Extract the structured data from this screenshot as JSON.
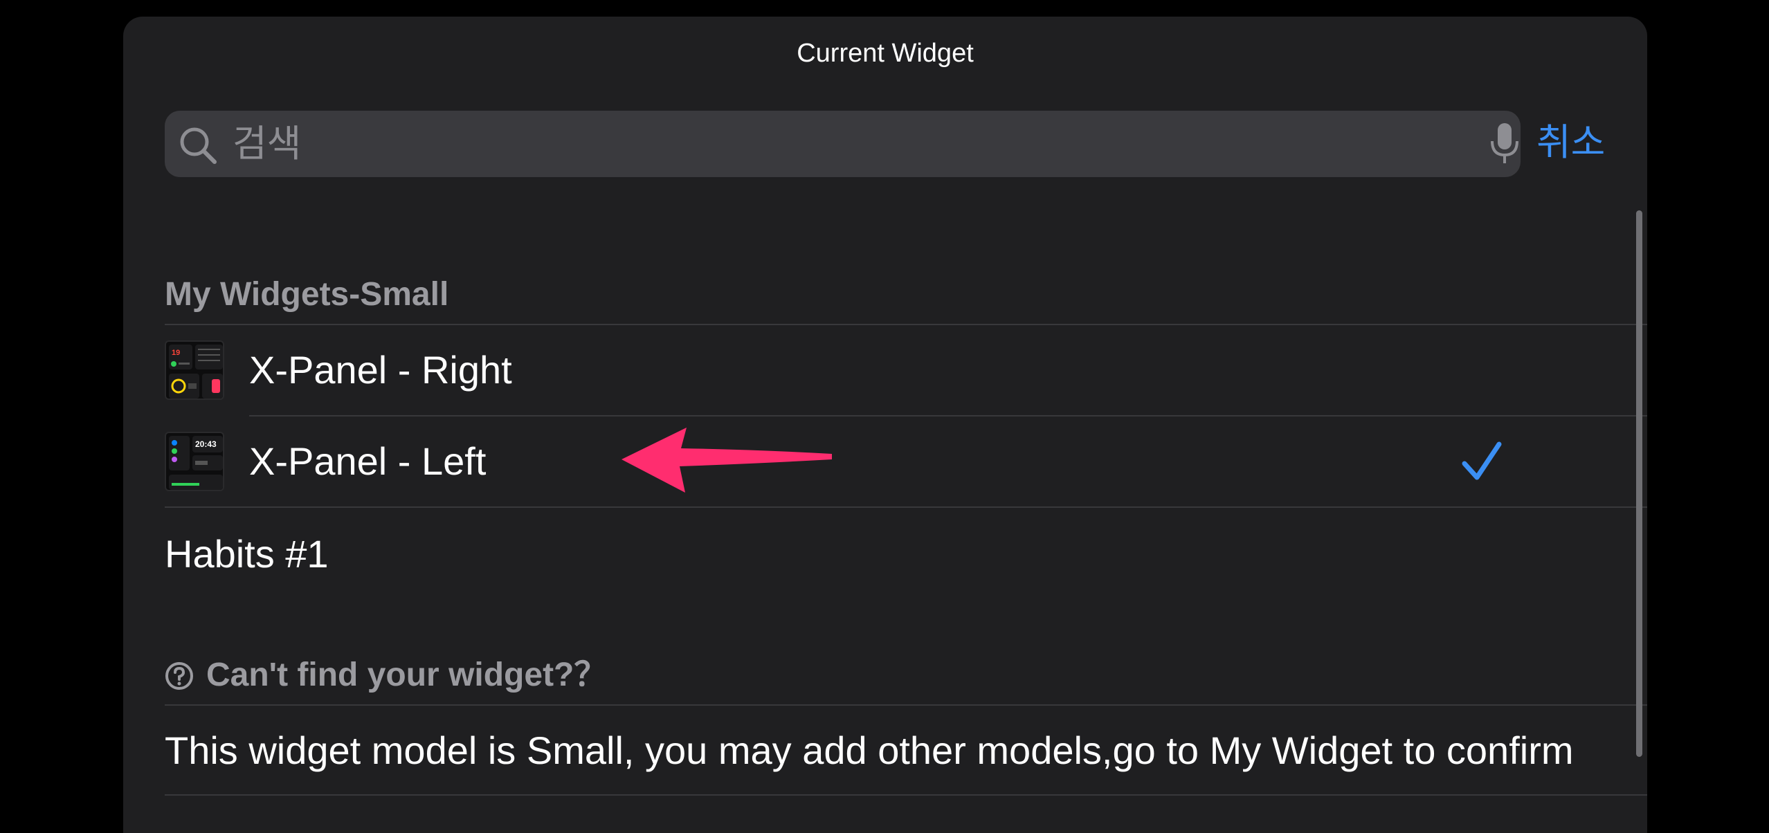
{
  "sheet": {
    "title": "Current Widget"
  },
  "search": {
    "placeholder": "검색",
    "cancel_label": "취소"
  },
  "section": {
    "title": "My Widgets-Small",
    "items": [
      {
        "label": "X-Panel - Right",
        "selected": false,
        "thumbnail": "widget-thumbnail"
      },
      {
        "label": "X-Panel - Left",
        "selected": true,
        "thumbnail": "widget-thumbnail"
      },
      {
        "label": "Habits #1",
        "selected": false
      }
    ]
  },
  "help": {
    "title": "Can't find your widget?？",
    "icon": "question-circle-icon",
    "info": "This widget model is Small, you may add other models,go to My Widget to confirm"
  },
  "thumb_text": {
    "right_date": "19",
    "left_time": "20:43"
  },
  "colors": {
    "accent": "#3b8ff4",
    "background": "#1f1f21",
    "annotation_arrow": "#ff2d6f"
  }
}
